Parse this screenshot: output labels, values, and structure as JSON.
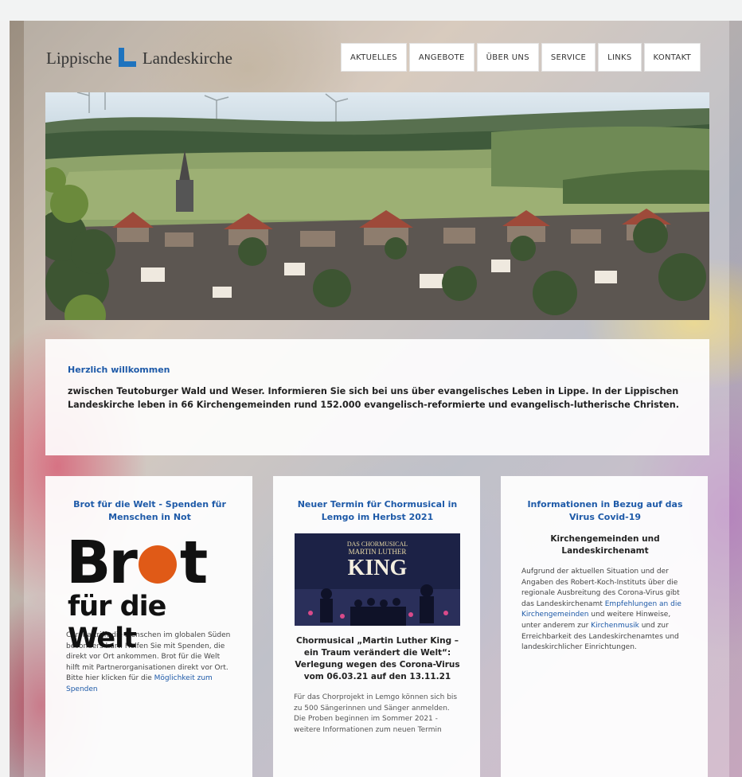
{
  "header": {
    "logo_left": "Lippische",
    "logo_right": "Landeskirche",
    "nav": [
      "AKTUELLES",
      "ANGEBOTE",
      "ÜBER UNS",
      "SERVICE",
      "LINKS",
      "KONTAKT"
    ]
  },
  "welcome": {
    "title": "Herzlich willkommen",
    "text": "zwischen Teutoburger Wald und Weser. Informieren Sie sich bei uns über evangelisches Leben in Lippe. In der Lippischen Landeskirche leben in 66 Kirchengemeinden rund 152.000 evangelisch-reformierte und evangelisch-lutherische Christen."
  },
  "cards": [
    {
      "title": "Brot für die Welt - Spenden für Menschen in Not",
      "logo_line1_a": "Br",
      "logo_line1_b": "t",
      "logo_line2": "für die Welt",
      "text_main": "Corona trifft die Menschen im globalen Süden besonders hart. Helfen Sie mit Spenden, die direkt vor Ort ankommen. Brot für die Welt hilft mit Partnerorganisationen direkt vor Ort. Bitte hier klicken für die ",
      "text_link": "Möglichkeit zum Spenden"
    },
    {
      "title": "Neuer Termin für Chormusical in Lemgo im Herbst 2021",
      "image_line1": "DAS CHORMUSICAL",
      "image_line2": "MARTIN LUTHER",
      "image_line3": "KING",
      "subtitle": "Chormusical „Martin Luther King – ein Traum verändert die Welt“: Verlegung wegen des Corona-Virus vom 06.03.21 auf den 13.11.21",
      "text": "Für das Chorprojekt in Lemgo können sich bis zu 500 Sängerinnen und Sänger anmelden. Die Proben beginnen im Sommer 2021 - weitere Informationen zum neuen Termin"
    },
    {
      "title": "Informationen in Bezug auf das Virus Covid-19",
      "subtitle": "Kirchengemeinden und Landeskirchenamt",
      "text_a": "Aufgrund der aktuellen Situation und der Angaben des Robert-Koch-Instituts über die regionale Ausbreitung des Corona-Virus gibt das Landeskirchenamt ",
      "text_link1": "Empfehlungen an die Kirchengemeinden",
      "text_b": " und weitere Hinweise, unter anderem zur ",
      "text_link2": "Kirchenmusik",
      "text_c": " und zur Erreichbarkeit des Landeskirchenamtes und landeskirchlicher Einrichtungen."
    }
  ],
  "colors": {
    "accent_blue": "#1e5aa8",
    "logo_blue": "#1e73be",
    "brot_orange": "#e05a17"
  }
}
